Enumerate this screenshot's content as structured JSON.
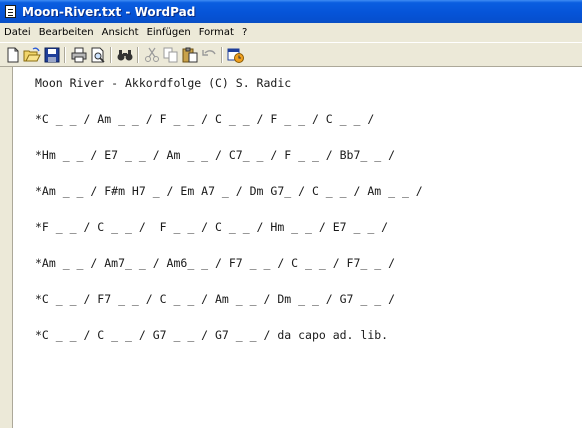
{
  "window": {
    "title": "Moon-River.txt - WordPad",
    "colors": {
      "titlebar": "#0654d8",
      "chrome": "#ece9d8",
      "text": "#1a1a1a"
    }
  },
  "menu": {
    "items": [
      "Datei",
      "Bearbeiten",
      "Ansicht",
      "Einfügen",
      "Format",
      "?"
    ]
  },
  "toolbar": {
    "icons": [
      "new-icon",
      "open-icon",
      "save-icon",
      "print-icon",
      "print-preview-icon",
      "find-icon",
      "cut-icon",
      "copy-icon",
      "paste-icon",
      "undo-icon",
      "date-time-icon"
    ]
  },
  "document": {
    "lines": [
      "Moon River - Akkordfolge (C) S. Radic",
      "*C _ _ / Am _ _ / F _ _ / C _ _ / F _ _ / C _ _ /",
      "*Hm _ _ / E7 _ _ / Am _ _ / C7_ _ / F _ _ / Bb7_ _ /",
      "*Am _ _ / F#m H7 _ / Em A7 _ / Dm G7_ / C _ _ / Am _ _ /",
      "*F _ _ / C _ _ /  F _ _ / C _ _ / Hm _ _ / E7 _ _ /",
      "*Am _ _ / Am7_ _ / Am6_ _ / F7 _ _ / C _ _ / F7_ _ /",
      "*C _ _ / F7 _ _ / C _ _ / Am _ _ / Dm _ _ / G7 _ _ /",
      "*C _ _ / C _ _ / G7 _ _ / G7 _ _ / da capo ad. lib."
    ]
  }
}
